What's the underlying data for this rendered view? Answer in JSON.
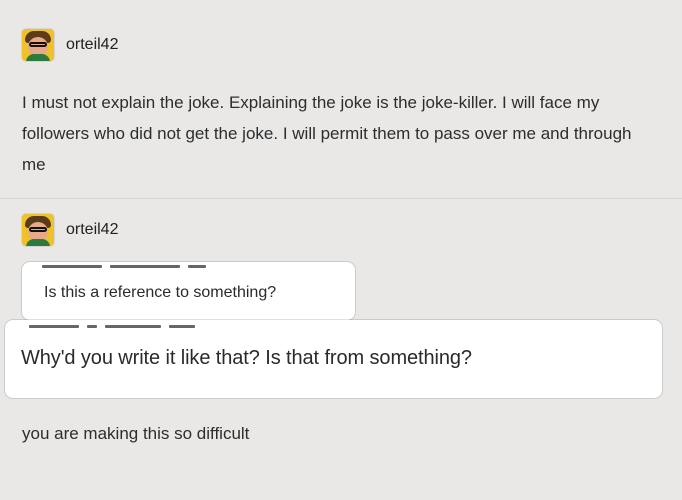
{
  "posts": [
    {
      "username": "orteil42",
      "text": "I must not explain the joke. Explaining the joke is the joke-killer. I will face my followers who did not get the joke. I will permit them to pass over me and through me"
    },
    {
      "username": "orteil42",
      "asks": [
        {
          "text": "Is this a reference to something?"
        },
        {
          "text": "Why'd you write it like that? Is that from something?"
        }
      ],
      "reply": "you are making this so difficult"
    }
  ],
  "icons": {
    "avatar": "avatar-icon"
  }
}
